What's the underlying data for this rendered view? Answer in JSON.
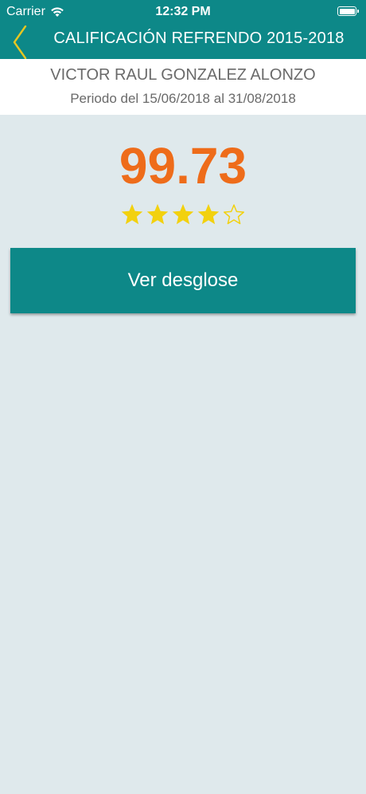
{
  "status_bar": {
    "carrier": "Carrier",
    "time": "12:32 PM"
  },
  "nav": {
    "title": "CALIFICACIÓN REFRENDO 2015-2018",
    "back_icon": "chevron-left-icon",
    "back_color": "#e7c621"
  },
  "header": {
    "name": "VICTOR RAUL GONZALEZ ALONZO",
    "period": "Periodo del 15/06/2018 al 31/08/2018"
  },
  "rating": {
    "score": "99.73",
    "stars_filled": 4,
    "stars_total": 5,
    "star_color": "#f2d10f"
  },
  "actions": {
    "breakdown_label": "Ver desglose"
  },
  "colors": {
    "primary": "#0d8888",
    "score": "#ee6c1a",
    "background": "#dfe9ec"
  }
}
